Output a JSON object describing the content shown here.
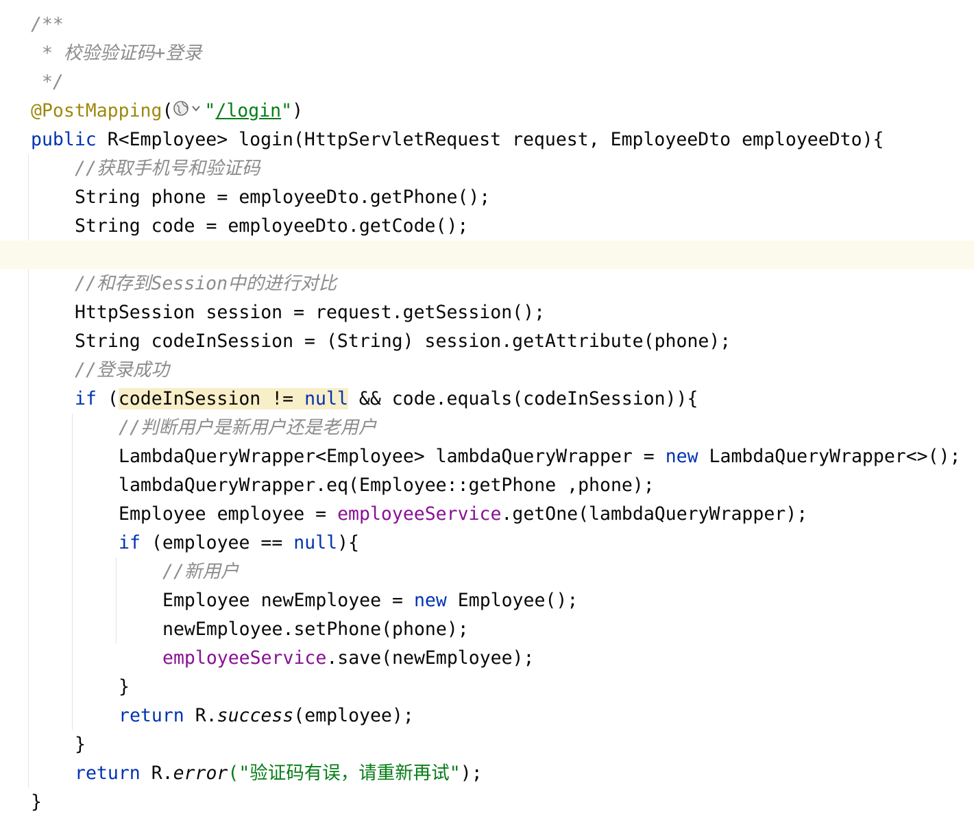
{
  "code_lines": [
    {
      "indent": 1,
      "segments": [
        {
          "t": "comment",
          "v": "/**"
        }
      ]
    },
    {
      "indent": 1,
      "segments": [
        {
          "t": "comment",
          "v": " * 校验验证码+登录"
        }
      ]
    },
    {
      "indent": 1,
      "segments": [
        {
          "t": "comment",
          "v": " */"
        }
      ]
    },
    {
      "indent": 1,
      "segments": [
        {
          "t": "annotation",
          "v": "@PostMapping"
        },
        {
          "t": "default",
          "v": "("
        },
        {
          "t": "icon",
          "v": "globe-icon"
        },
        {
          "t": "string",
          "v": "\""
        },
        {
          "t": "url",
          "v": "/login"
        },
        {
          "t": "string",
          "v": "\""
        },
        {
          "t": "default",
          "v": ")"
        }
      ]
    },
    {
      "indent": 1,
      "segments": [
        {
          "t": "keyword",
          "v": "public"
        },
        {
          "t": "default",
          "v": " R<Employee> "
        },
        {
          "t": "method",
          "v": "login"
        },
        {
          "t": "default",
          "v": "(HttpServletRequest request, EmployeeDto employeeDto){"
        }
      ]
    },
    {
      "indent": 2,
      "segments": [
        {
          "t": "comment",
          "v": "//获取手机号和验证码"
        }
      ]
    },
    {
      "indent": 2,
      "segments": [
        {
          "t": "default",
          "v": "String phone = employeeDto.getPhone();"
        }
      ]
    },
    {
      "indent": 2,
      "segments": [
        {
          "t": "default",
          "v": "String code = employeeDto.getCode();"
        }
      ]
    },
    {
      "indent": 2,
      "current": true,
      "segments": []
    },
    {
      "indent": 2,
      "segments": [
        {
          "t": "comment",
          "v": "//和存到Session中的进行对比"
        }
      ]
    },
    {
      "indent": 2,
      "segments": [
        {
          "t": "default",
          "v": "HttpSession session = request.getSession();"
        }
      ]
    },
    {
      "indent": 2,
      "segments": [
        {
          "t": "default",
          "v": "String codeInSession = (String) session.getAttribute(phone);"
        }
      ]
    },
    {
      "indent": 2,
      "segments": [
        {
          "t": "comment",
          "v": "//登录成功"
        }
      ]
    },
    {
      "indent": 2,
      "segments": [
        {
          "t": "keyword",
          "v": "if"
        },
        {
          "t": "default",
          "v": " ("
        },
        {
          "t": "highlight",
          "v": "codeInSession != "
        },
        {
          "t": "highlight-kw",
          "v": "null"
        },
        {
          "t": "default",
          "v": " && code.equals(codeInSession)){"
        }
      ]
    },
    {
      "indent": 3,
      "segments": [
        {
          "t": "comment",
          "v": "//判断用户是新用户还是老用户"
        }
      ]
    },
    {
      "indent": 3,
      "segments": [
        {
          "t": "default",
          "v": "LambdaQueryWrapper<Employee> lambdaQueryWrapper = "
        },
        {
          "t": "keyword",
          "v": "new"
        },
        {
          "t": "default",
          "v": " LambdaQueryWrapper<>();"
        }
      ]
    },
    {
      "indent": 3,
      "segments": [
        {
          "t": "default",
          "v": "lambdaQueryWrapper.eq(Employee::getPhone ,phone);"
        }
      ]
    },
    {
      "indent": 3,
      "segments": [
        {
          "t": "default",
          "v": "Employee employee = "
        },
        {
          "t": "field",
          "v": "employeeService"
        },
        {
          "t": "default",
          "v": ".getOne(lambdaQueryWrapper);"
        }
      ]
    },
    {
      "indent": 3,
      "segments": [
        {
          "t": "keyword",
          "v": "if"
        },
        {
          "t": "default",
          "v": " (employee == "
        },
        {
          "t": "keyword",
          "v": "null"
        },
        {
          "t": "default",
          "v": "){"
        }
      ]
    },
    {
      "indent": 4,
      "segments": [
        {
          "t": "comment",
          "v": "//新用户"
        }
      ]
    },
    {
      "indent": 4,
      "segments": [
        {
          "t": "default",
          "v": "Employee newEmployee = "
        },
        {
          "t": "keyword",
          "v": "new"
        },
        {
          "t": "default",
          "v": " Employee();"
        }
      ]
    },
    {
      "indent": 4,
      "segments": [
        {
          "t": "default",
          "v": "newEmployee.setPhone(phone);"
        }
      ]
    },
    {
      "indent": 4,
      "segments": [
        {
          "t": "field",
          "v": "employeeService"
        },
        {
          "t": "default",
          "v": ".save(newEmployee);"
        }
      ]
    },
    {
      "indent": 3,
      "segments": [
        {
          "t": "default",
          "v": "}"
        }
      ]
    },
    {
      "indent": 3,
      "segments": [
        {
          "t": "keyword",
          "v": "return"
        },
        {
          "t": "default",
          "v": " R."
        },
        {
          "t": "static-call",
          "v": "success"
        },
        {
          "t": "default",
          "v": "(employee);"
        }
      ]
    },
    {
      "indent": 2,
      "segments": [
        {
          "t": "default",
          "v": "}"
        }
      ]
    },
    {
      "indent": 2,
      "segments": [
        {
          "t": "keyword",
          "v": "return"
        },
        {
          "t": "default",
          "v": " R."
        },
        {
          "t": "static-call",
          "v": "error"
        },
        {
          "t": "string",
          "v": "(\"验证码有误，请重新再试\""
        },
        {
          "t": "default",
          "v": ");"
        }
      ]
    },
    {
      "indent": 1,
      "segments": [
        {
          "t": "default",
          "v": "}"
        }
      ]
    }
  ],
  "colors": {
    "keyword": "#0033b3",
    "comment": "#8c8c8c",
    "annotation": "#9e880d",
    "string": "#067d17",
    "field": "#871094",
    "default": "#080808",
    "highlight_bg": "#f8eec8",
    "current_line_bg": "#fcfaed"
  }
}
